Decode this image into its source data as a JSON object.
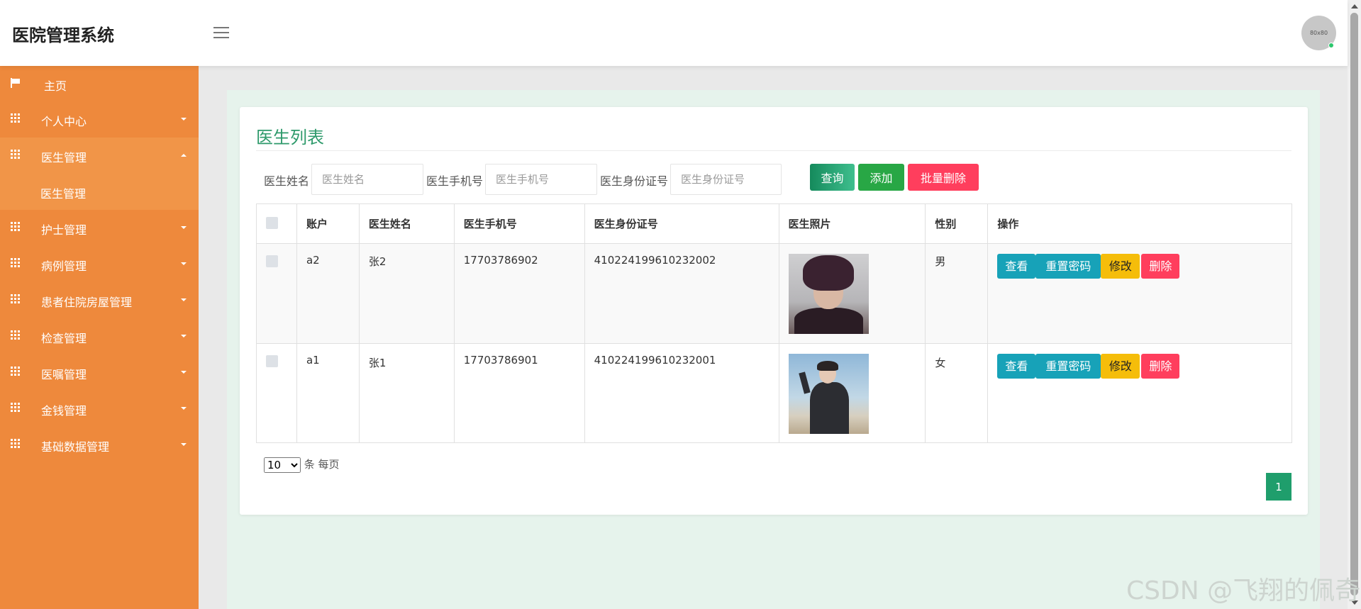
{
  "header": {
    "title": "医院管理系统",
    "avatar_text": "80x80"
  },
  "sidebar": {
    "home": {
      "label": "主页",
      "icon": "flag-icon"
    },
    "items": [
      {
        "label": "个人中心",
        "icon": "grid-icon"
      },
      {
        "label": "医生管理",
        "icon": "grid-icon",
        "expanded": true,
        "sub": [
          {
            "label": "医生管理"
          }
        ]
      },
      {
        "label": "护士管理",
        "icon": "grid-icon"
      },
      {
        "label": "病例管理",
        "icon": "grid-icon"
      },
      {
        "label": "患者住院房屋管理",
        "icon": "grid-icon"
      },
      {
        "label": "检查管理",
        "icon": "grid-icon"
      },
      {
        "label": "医嘱管理",
        "icon": "grid-icon"
      },
      {
        "label": "金钱管理",
        "icon": "grid-icon"
      },
      {
        "label": "基础数据管理",
        "icon": "grid-icon"
      }
    ]
  },
  "panel": {
    "title": "医生列表"
  },
  "search": {
    "name_label": "医生姓名",
    "name_placeholder": "医生姓名",
    "phone_label": "医生手机号",
    "phone_placeholder": "医生手机号",
    "id_label": "医生身份证号",
    "id_placeholder": "医生身份证号",
    "query_button": "查询",
    "add_button": "添加",
    "batch_delete_button": "批量删除"
  },
  "table": {
    "columns": [
      "账户",
      "医生姓名",
      "医生手机号",
      "医生身份证号",
      "医生照片",
      "性别",
      "操作"
    ],
    "rows": [
      {
        "account": "a2",
        "name": "张2",
        "phone": "17703786902",
        "id_number": "410224199610232002",
        "gender": "男"
      },
      {
        "account": "a1",
        "name": "张1",
        "phone": "17703786901",
        "id_number": "410224199610232001",
        "gender": "女"
      }
    ],
    "actions": {
      "view": "查看",
      "reset": "重置密码",
      "edit": "修改",
      "delete": "删除"
    }
  },
  "pagination": {
    "per_page_value": "10",
    "per_page_options": [
      "10"
    ],
    "per_page_suffix": "条 每页",
    "current_page": "1"
  },
  "watermark": "CSDN @飞翔的佩奇",
  "colors": {
    "sidebar": "#ee893c",
    "title": "#2e9a6b",
    "query": "#1f9e6c",
    "add": "#28a745",
    "danger": "#ff3e5d",
    "info": "#17a2b8",
    "warning": "#f5bd0a"
  }
}
